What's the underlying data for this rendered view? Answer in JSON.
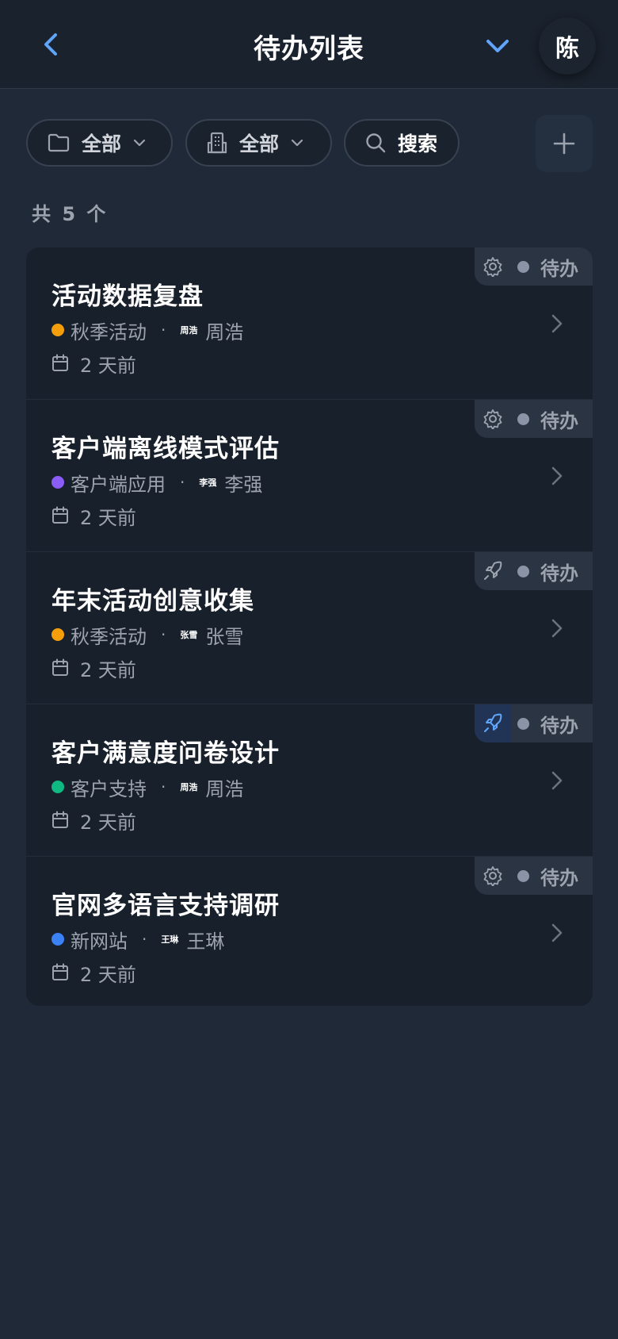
{
  "header": {
    "title": "待办列表",
    "avatar_text": "陈"
  },
  "filters": {
    "folder_label": "全部",
    "building_label": "全部",
    "search_label": "搜索"
  },
  "count_text": "共 5 个",
  "colors": {
    "accent": "#60a5fa",
    "orange": "#f59e0b",
    "purple": "#8b5cf6",
    "green": "#10b981",
    "blue": "#3b82f6"
  },
  "items": [
    {
      "title": "活动数据复盘",
      "project": "秋季活动",
      "project_color": "#f59e0b",
      "avatar_text": "周浩",
      "assignee": "周浩",
      "date": "2 天前",
      "status": "待办",
      "type_icon": "gear-icon"
    },
    {
      "title": "客户端离线模式评估",
      "project": "客户端应用",
      "project_color": "#8b5cf6",
      "avatar_text": "李强",
      "assignee": "李强",
      "date": "2 天前",
      "status": "待办",
      "type_icon": "gear-icon"
    },
    {
      "title": "年末活动创意收集",
      "project": "秋季活动",
      "project_color": "#f59e0b",
      "avatar_text": "张雪",
      "assignee": "张雪",
      "date": "2 天前",
      "status": "待办",
      "type_icon": "rocket-icon"
    },
    {
      "title": "客户满意度问卷设计",
      "project": "客户支持",
      "project_color": "#10b981",
      "avatar_text": "周浩",
      "assignee": "周浩",
      "date": "2 天前",
      "status": "待办",
      "type_icon": "rocket-icon-active"
    },
    {
      "title": "官网多语言支持调研",
      "project": "新网站",
      "project_color": "#3b82f6",
      "avatar_text": "王琳",
      "assignee": "王琳",
      "date": "2 天前",
      "status": "待办",
      "type_icon": "gear-icon"
    }
  ]
}
